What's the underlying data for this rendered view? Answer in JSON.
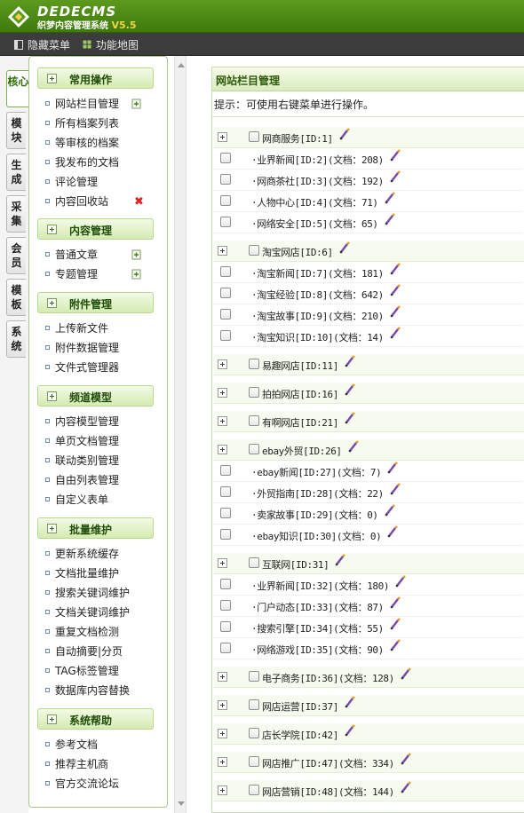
{
  "app": {
    "logo_text": "DEDECMS",
    "logo_sub": "织梦内容管理系统",
    "version": "V5.5"
  },
  "toolbar": {
    "hide_menu": "隐藏菜单",
    "function_map": "功能地图"
  },
  "vtabs": [
    {
      "label": "核心",
      "active": true
    },
    {
      "label": "模块",
      "active": false
    },
    {
      "label": "生成",
      "active": false
    },
    {
      "label": "采集",
      "active": false
    },
    {
      "label": "会员",
      "active": false
    },
    {
      "label": "模板",
      "active": false
    },
    {
      "label": "系统",
      "active": false
    }
  ],
  "sidebar": {
    "sections": [
      {
        "title": "常用操作",
        "items": [
          {
            "label": "网站栏目管理",
            "icon": "add-icon"
          },
          {
            "label": "所有档案列表"
          },
          {
            "label": "等审核的档案"
          },
          {
            "label": "我发布的文档"
          },
          {
            "label": "评论管理"
          },
          {
            "label": "内容回收站",
            "icon": "delete-icon"
          }
        ]
      },
      {
        "title": "内容管理",
        "items": [
          {
            "label": "普通文章",
            "icon": "add-icon"
          },
          {
            "label": "专题管理",
            "icon": "add-icon"
          }
        ]
      },
      {
        "title": "附件管理",
        "items": [
          {
            "label": "上传新文件"
          },
          {
            "label": "附件数据管理"
          },
          {
            "label": "文件式管理器"
          }
        ]
      },
      {
        "title": "频道模型",
        "items": [
          {
            "label": "内容模型管理"
          },
          {
            "label": "单页文档管理"
          },
          {
            "label": "联动类别管理"
          },
          {
            "label": "自由列表管理"
          },
          {
            "label": "自定义表单"
          }
        ]
      },
      {
        "title": "批量维护",
        "items": [
          {
            "label": "更新系统缓存"
          },
          {
            "label": "文档批量维护"
          },
          {
            "label": "搜索关键词维护"
          },
          {
            "label": "文档关键词维护"
          },
          {
            "label": "重复文档检测"
          },
          {
            "label": "自动摘要|分页"
          },
          {
            "label": "TAG标签管理"
          },
          {
            "label": "数据库内容替换"
          }
        ]
      },
      {
        "title": "系统帮助",
        "items": [
          {
            "label": "参考文档"
          },
          {
            "label": "推荐主机商"
          },
          {
            "label": "官方交流论坛"
          }
        ]
      }
    ]
  },
  "main": {
    "title": "网站栏目管理",
    "hint": "提示：可使用右键菜单进行操作。",
    "rows": [
      {
        "type": "top",
        "label": "网商服务[ID:1]"
      },
      {
        "type": "sub",
        "label": "·业界新闻[ID:2](文档：208)"
      },
      {
        "type": "sub",
        "label": "·网商茶社[ID:3](文档：192)"
      },
      {
        "type": "sub",
        "label": "·人物中心[ID:4](文档：71)"
      },
      {
        "type": "sub",
        "label": "·网络安全[ID:5](文档：65)"
      },
      {
        "type": "top",
        "label": "淘宝网店[ID:6]"
      },
      {
        "type": "sub",
        "label": "·淘宝新闻[ID:7](文档：181)"
      },
      {
        "type": "sub",
        "label": "·淘宝经验[ID:8](文档：642)"
      },
      {
        "type": "sub",
        "label": "·淘宝故事[ID:9](文档：210)"
      },
      {
        "type": "sub",
        "label": "·淘宝知识[ID:10](文档：14)"
      },
      {
        "type": "top",
        "label": "易趣网店[ID:11]"
      },
      {
        "type": "top",
        "label": "拍拍网店[ID:16]"
      },
      {
        "type": "top",
        "label": "有啊网店[ID:21]"
      },
      {
        "type": "top",
        "label": "ebay外贸[ID:26]"
      },
      {
        "type": "sub",
        "label": "·ebay新闻[ID:27](文档：7)"
      },
      {
        "type": "sub",
        "label": "·外贸指南[ID:28](文档：22)"
      },
      {
        "type": "sub",
        "label": "·卖家故事[ID:29](文档：0)"
      },
      {
        "type": "sub",
        "label": "·ebay知识[ID:30](文档：0)"
      },
      {
        "type": "top",
        "label": "互联网[ID:31]"
      },
      {
        "type": "sub",
        "label": "·业界新闻[ID:32](文档：180)"
      },
      {
        "type": "sub",
        "label": "·门户动态[ID:33](文档：87)"
      },
      {
        "type": "sub",
        "label": "·搜索引擎[ID:34](文档：55)"
      },
      {
        "type": "sub",
        "label": "·网络游戏[ID:35](文档：90)"
      },
      {
        "type": "top",
        "label": "电子商务[ID:36](文档：128)"
      },
      {
        "type": "top",
        "label": "网店运营[ID:37]"
      },
      {
        "type": "top",
        "label": "店长学院[ID:42]"
      },
      {
        "type": "top",
        "label": "网店推广[ID:47](文档：334)"
      },
      {
        "type": "top",
        "label": "网店营销[ID:48](文档：144)"
      }
    ]
  }
}
